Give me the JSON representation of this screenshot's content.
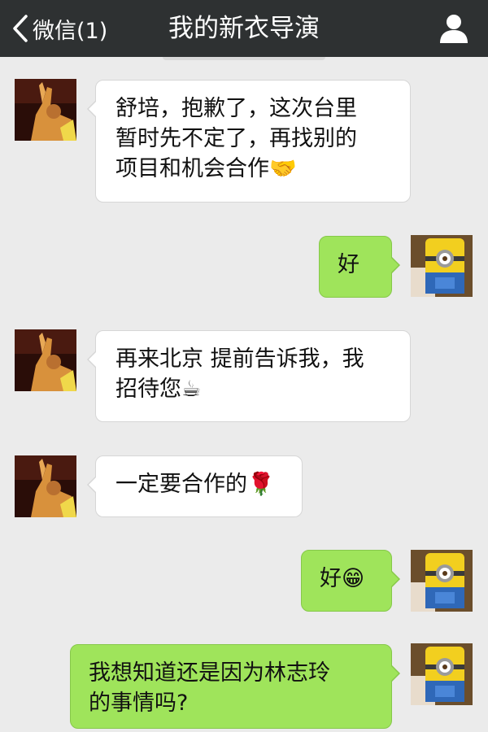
{
  "header": {
    "back_label": "微信(1)",
    "title": "我的新衣导演"
  },
  "messages": [
    {
      "side": "in",
      "lines": [
        "舒培，抱歉了，这次台里",
        "暂时先不定了，再找别的",
        "项目和机会合作🤝"
      ]
    },
    {
      "side": "out",
      "lines": [
        "好"
      ]
    },
    {
      "side": "in",
      "lines": [
        "再来北京 提前告诉我，我",
        "招待您☕"
      ]
    },
    {
      "side": "in",
      "lines": [
        "一定要合作的🌹"
      ]
    },
    {
      "side": "out",
      "lines": [
        "好😁"
      ]
    },
    {
      "side": "out",
      "lines": [
        "我想知道还是因为林志玲",
        "的事情吗?"
      ]
    }
  ],
  "icons": {
    "back": "chevron-left-icon",
    "profile": "person-icon",
    "contact_avatar": "contact-avatar",
    "my_avatar": "minion-avatar"
  },
  "colors": {
    "navbar": "#2e3132",
    "chat_background": "#ebebeb",
    "incoming_bubble": "#ffffff",
    "outgoing_bubble": "#9fe45b"
  }
}
